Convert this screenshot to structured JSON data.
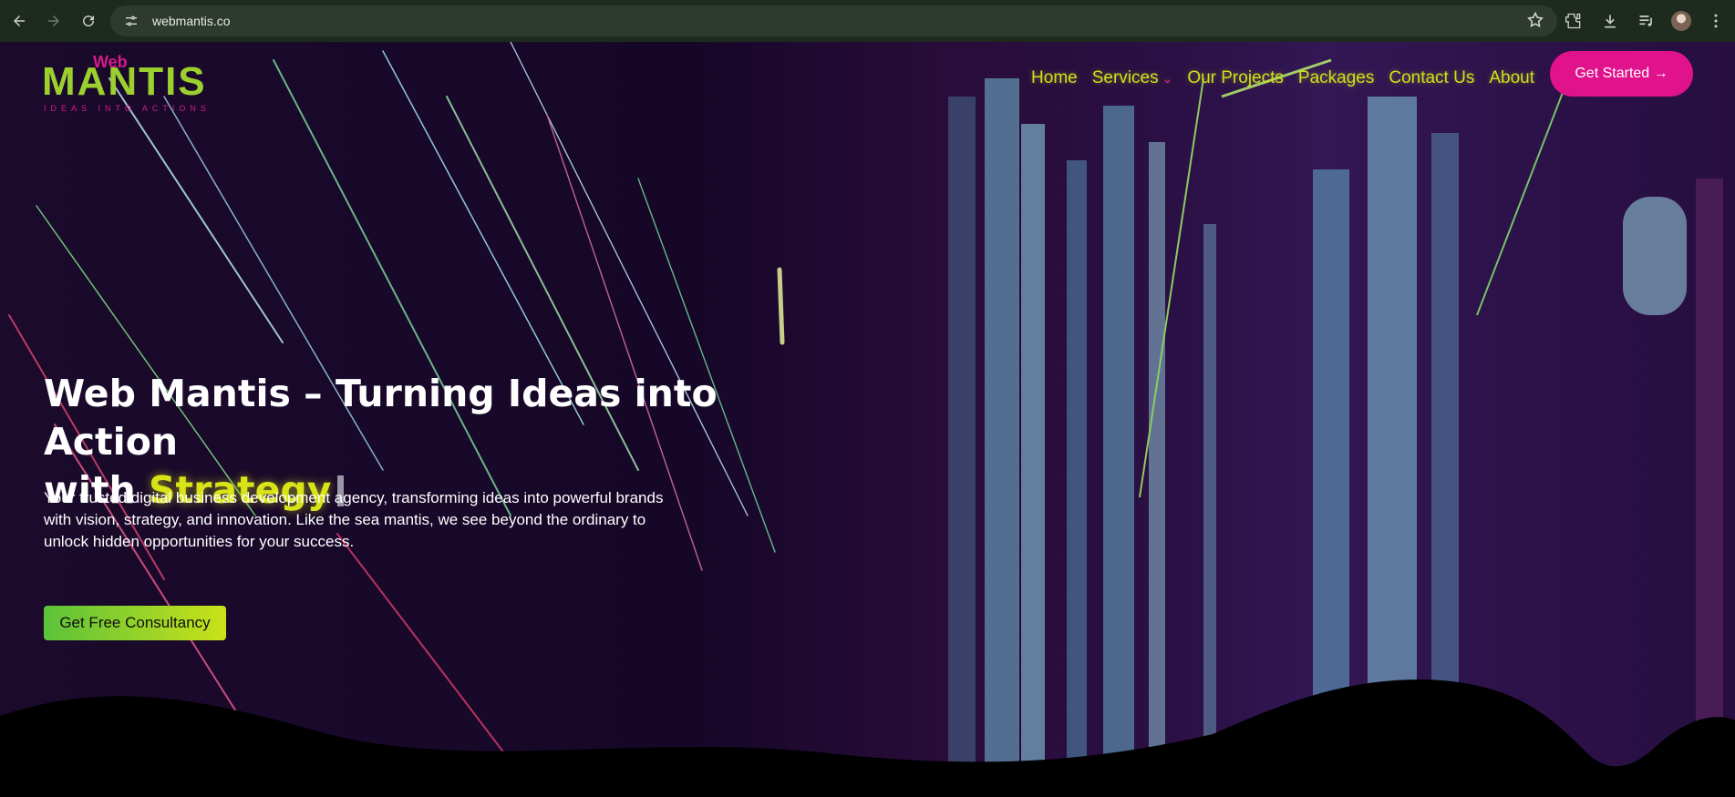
{
  "browser": {
    "url": "webmantis.co",
    "icons": [
      "back-icon",
      "forward-icon",
      "reload-icon",
      "site-info-icon",
      "bookmark-star-icon",
      "extensions-icon",
      "downloads-icon",
      "media-control-icon",
      "profile-avatar"
    ]
  },
  "header": {
    "logo": {
      "web": "Web",
      "mantis": "MANTIS",
      "tagline": "IDEAS INTO ACTIONS"
    },
    "nav": [
      {
        "label": "Home"
      },
      {
        "label": "Services",
        "has_dropdown": true
      },
      {
        "label": "Our Projects"
      },
      {
        "label": "Packages"
      },
      {
        "label": "Contact Us"
      },
      {
        "label": "About"
      }
    ],
    "cta_label": "Get Started →"
  },
  "hero": {
    "title_line1": "Web Mantis – Turning Ideas into Action",
    "title_line2_prefix": "with",
    "title_accent": "Strategy",
    "description": "Your trusted digital business development agency, transforming ideas into powerful brands with vision, strategy, and innovation. Like the sea mantis, we see beyond the ordinary to unlock hidden opportunities for your success.",
    "cta_label": "Get Free Consultancy"
  },
  "colors": {
    "accent_yellow": "#d8e418",
    "accent_pink": "#e0138c",
    "logo_green": "#9bd02e",
    "background": "#1b0a2b"
  }
}
